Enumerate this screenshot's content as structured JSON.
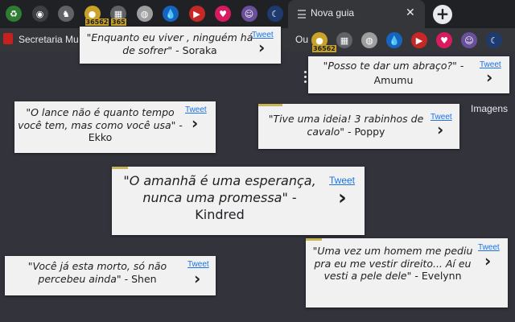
{
  "browser": {
    "active_tab_title": "Nova guia",
    "tab_close_glyph": "✕",
    "new_tab_glyph": "+",
    "bookmark_label": "Secretaria Mu",
    "bookmark_label_2": "Ou",
    "side_link": "Imagens",
    "tab_extensions": [
      {
        "icon": "recycle-icon",
        "color": "#2e7d32",
        "glyph": "♻"
      },
      {
        "icon": "goggles-icon",
        "color": "#3c4043",
        "glyph": "◉"
      },
      {
        "icon": "figure-icon",
        "color": "#5f6368",
        "glyph": "♞"
      },
      {
        "icon": "coin-icon",
        "color": "#c9a227",
        "glyph": "●",
        "badge": "36562"
      },
      {
        "icon": "calendar-icon",
        "color": "#5f6368",
        "glyph": "▦",
        "badge": "365"
      },
      {
        "icon": "shell-icon",
        "color": "#9e9e9e",
        "glyph": "◍"
      },
      {
        "icon": "drop-icon",
        "color": "#1565c0",
        "glyph": "💧"
      },
      {
        "icon": "youtube-icon",
        "color": "#c62828",
        "glyph": "▶"
      },
      {
        "icon": "heart-icon",
        "color": "#d81b60",
        "glyph": "♥"
      },
      {
        "icon": "avatar-icon",
        "color": "#6a4f9c",
        "glyph": "☺"
      },
      {
        "icon": "moon-icon",
        "color": "#1e3a6e",
        "glyph": "☾"
      }
    ],
    "toolbar_extensions": [
      {
        "icon": "coin-icon",
        "color": "#c9a227",
        "glyph": "●",
        "badge": "36562"
      },
      {
        "icon": "calendar-icon",
        "color": "#5f6368",
        "glyph": "▦"
      },
      {
        "icon": "shell-icon",
        "color": "#9e9e9e",
        "glyph": "◍"
      },
      {
        "icon": "drop-icon",
        "color": "#1565c0",
        "glyph": "💧"
      },
      {
        "icon": "youtube-icon",
        "color": "#c62828",
        "glyph": "▶"
      },
      {
        "icon": "heart-icon",
        "color": "#d81b60",
        "glyph": "♥"
      },
      {
        "icon": "avatar-icon",
        "color": "#6a4f9c",
        "glyph": "☺"
      },
      {
        "icon": "moon-icon",
        "color": "#1e3a6e",
        "glyph": "☾"
      }
    ]
  },
  "tweet_label": "Tweet",
  "chevron_glyph": "›",
  "quotes": [
    {
      "id": "soraka",
      "text": "\"Enquanto eu viver , ninguém há de sofrer\"",
      "author": "Soraka"
    },
    {
      "id": "amumu",
      "text": "\"Posso te dar um abraço?\"",
      "author": "Amumu"
    },
    {
      "id": "ekko",
      "text": "\"O lance não é quanto tempo você tem, mas como você usa\"",
      "author": "Ekko"
    },
    {
      "id": "poppy",
      "text": "\"Tive uma ideia! 3 rabinhos de cavalo\"",
      "author": "Poppy"
    },
    {
      "id": "kindred",
      "text": "\"O amanhã é uma esperança, nunca uma promessa\"",
      "author": "Kindred"
    },
    {
      "id": "evelynn",
      "text": "\"Uma vez um homem me pediu pra eu me vestir direito... Aí eu vesti a pele dele\"",
      "author": "Evelynn"
    },
    {
      "id": "shen",
      "text": "\"Você já esta morto, só não percebeu ainda\"",
      "author": "Shen"
    }
  ]
}
